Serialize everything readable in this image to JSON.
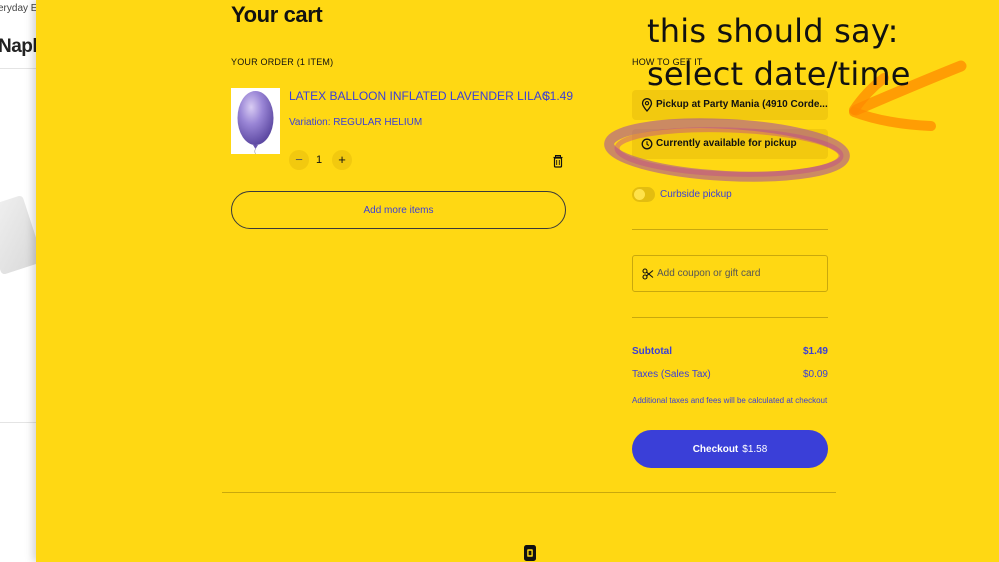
{
  "background_page": {
    "breadcrumb_fragment": "eryday Ent",
    "title_fragment": "Napki"
  },
  "cart": {
    "title": "Your cart",
    "order_header": "YOUR ORDER (1 ITEM)",
    "item": {
      "name": "LATEX BALLOON INFLATED LAVENDER LILAC",
      "price": "$1.49",
      "variation": "Variation: REGULAR HELIUM",
      "quantity": "1",
      "minus_label": "−",
      "plus_label": "+"
    },
    "add_more_label": "Add more items"
  },
  "fulfillment": {
    "header": "HOW TO GET IT",
    "pickup_label": "Pickup at Party Mania (4910 Corde...",
    "availability_label": "Currently available for pickup",
    "curbside_label": "Curbside pickup",
    "curbside_enabled": false
  },
  "coupon": {
    "placeholder": "Add coupon or gift card"
  },
  "summary": {
    "subtotal_label": "Subtotal",
    "subtotal_value": "$1.49",
    "tax_label": "Taxes (Sales Tax)",
    "tax_value": "$0.09",
    "note": "Additional taxes and fees will be calculated at checkout",
    "checkout_label": "Checkout",
    "checkout_total": "$1.58"
  },
  "annotation": {
    "line1": "this should say:",
    "line2": "select date/time"
  },
  "colors": {
    "panel_bg": "#ffd813",
    "accent_blue": "#3a3fd8",
    "button_yellow": "#f2c90f",
    "annotation_orange": "#ff8a00",
    "annotation_purple": "#a04aa6"
  },
  "icons": {
    "location": "map-pin-icon",
    "clock": "clock-icon",
    "coupon": "scissors-icon",
    "trash": "trash-icon",
    "footer": "square-logo"
  }
}
